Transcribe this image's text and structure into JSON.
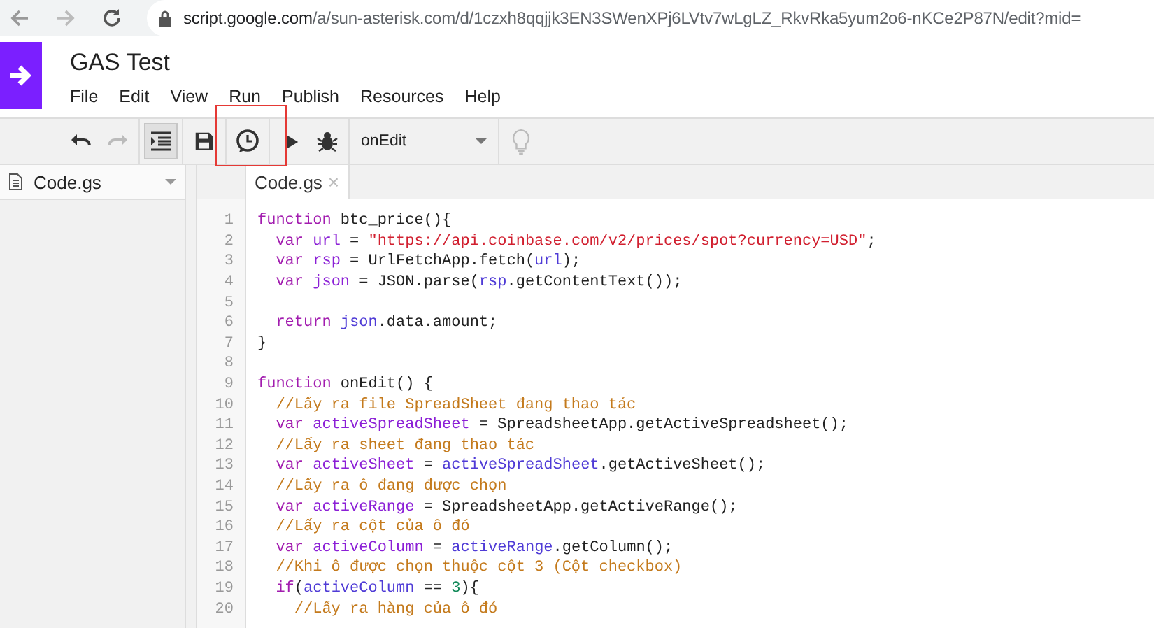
{
  "browser": {
    "url_host": "script.google.com",
    "url_path": "/a/sun-asterisk.com/d/1czxh8qqjjk3EN3SWenXPj6LVtv7wLgLZ_RkvRka5yum2o6-nKCe2P87N/edit?mid="
  },
  "project": {
    "title": "GAS Test"
  },
  "menu": [
    "File",
    "Edit",
    "View",
    "Run",
    "Publish",
    "Resources",
    "Help"
  ],
  "toolbar": [
    {
      "kind": "undo",
      "disabled": false,
      "selected": false
    },
    {
      "kind": "redo",
      "disabled": true,
      "selected": false
    },
    {
      "kind": "indent",
      "disabled": false,
      "selected": true
    },
    {
      "kind": "save",
      "disabled": false,
      "selected": false
    },
    {
      "kind": "triggers",
      "disabled": false,
      "selected": false,
      "highlighted": true
    },
    {
      "kind": "run",
      "disabled": false,
      "selected": false
    },
    {
      "kind": "debug",
      "disabled": false,
      "selected": false
    },
    {
      "kind": "function_select",
      "value": "onEdit"
    },
    {
      "kind": "bulb",
      "disabled": true,
      "selected": false
    }
  ],
  "sidebar": {
    "files": [
      {
        "name": "Code.gs"
      }
    ]
  },
  "tabs": [
    {
      "label": "Code.gs",
      "close": "×",
      "selected": true
    }
  ],
  "code": [
    {
      "n": "1",
      "tokens": [
        {
          "kind": "kw",
          "text": "function"
        },
        {
          "kind": "plain",
          "text": " btc_price(){"
        }
      ]
    },
    {
      "n": "2",
      "tokens": [
        {
          "kind": "kw",
          "text": "  var"
        },
        {
          "kind": "def",
          "text": " url"
        },
        {
          "kind": "plain",
          "text": " = "
        },
        {
          "kind": "str",
          "text": "\"https://api.coinbase.com/v2/prices/spot?currency=USD\""
        },
        {
          "kind": "plain",
          "text": ";"
        }
      ]
    },
    {
      "n": "3",
      "tokens": [
        {
          "kind": "kw",
          "text": "  var"
        },
        {
          "kind": "def",
          "text": " rsp"
        },
        {
          "kind": "plain",
          "text": " = UrlFetchApp.fetch("
        },
        {
          "kind": "var",
          "text": "url"
        },
        {
          "kind": "plain",
          "text": ");"
        }
      ]
    },
    {
      "n": "4",
      "tokens": [
        {
          "kind": "kw",
          "text": "  var"
        },
        {
          "kind": "def",
          "text": " json"
        },
        {
          "kind": "plain",
          "text": " = JSON.parse("
        },
        {
          "kind": "var",
          "text": "rsp"
        },
        {
          "kind": "plain",
          "text": ".getContentText());"
        }
      ]
    },
    {
      "n": "5"
    },
    {
      "n": "6",
      "tokens": [
        {
          "kind": "kw",
          "text": "  return"
        },
        {
          "kind": "var",
          "text": " json"
        },
        {
          "kind": "plain",
          "text": ".data.amount;"
        }
      ]
    },
    {
      "n": "7",
      "tokens": [
        {
          "kind": "plain",
          "text": "}"
        }
      ]
    },
    {
      "n": "8"
    },
    {
      "n": "9",
      "tokens": [
        {
          "kind": "kw",
          "text": "function"
        },
        {
          "kind": "plain",
          "text": " onEdit() {"
        }
      ]
    },
    {
      "n": "10",
      "tokens": [
        {
          "kind": "com",
          "text": "  //Lấy ra file SpreadSheet đang thao tác"
        }
      ]
    },
    {
      "n": "11",
      "tokens": [
        {
          "kind": "kw",
          "text": "  var"
        },
        {
          "kind": "def",
          "text": " activeSpreadSheet"
        },
        {
          "kind": "plain",
          "text": " = SpreadsheetApp.getActiveSpreadsheet();"
        }
      ]
    },
    {
      "n": "12",
      "tokens": [
        {
          "kind": "com",
          "text": "  //Lấy ra sheet đang thao tác"
        }
      ]
    },
    {
      "n": "13",
      "tokens": [
        {
          "kind": "kw",
          "text": "  var"
        },
        {
          "kind": "def",
          "text": " activeSheet"
        },
        {
          "kind": "plain",
          "text": " = "
        },
        {
          "kind": "var",
          "text": "activeSpreadSheet"
        },
        {
          "kind": "plain",
          "text": ".getActiveSheet();"
        }
      ]
    },
    {
      "n": "14",
      "tokens": [
        {
          "kind": "com",
          "text": "  //Lấy ra ô đang được chọn"
        }
      ]
    },
    {
      "n": "15",
      "tokens": [
        {
          "kind": "kw",
          "text": "  var"
        },
        {
          "kind": "def",
          "text": " activeRange"
        },
        {
          "kind": "plain",
          "text": " = SpreadsheetApp.getActiveRange();"
        }
      ]
    },
    {
      "n": "16",
      "tokens": [
        {
          "kind": "com",
          "text": "  //Lấy ra cột của ô đó"
        }
      ]
    },
    {
      "n": "17",
      "tokens": [
        {
          "kind": "kw",
          "text": "  var"
        },
        {
          "kind": "def",
          "text": " activeColumn"
        },
        {
          "kind": "plain",
          "text": " = "
        },
        {
          "kind": "var",
          "text": "activeRange"
        },
        {
          "kind": "plain",
          "text": ".getColumn();"
        }
      ]
    },
    {
      "n": "18",
      "tokens": [
        {
          "kind": "com",
          "text": "  //Khi ô được chọn thuộc cột 3 (Cột checkbox)"
        }
      ]
    },
    {
      "n": "19",
      "tokens": [
        {
          "kind": "kw",
          "text": "  if"
        },
        {
          "kind": "plain",
          "text": "("
        },
        {
          "kind": "var",
          "text": "activeColumn"
        },
        {
          "kind": "plain",
          "text": " == "
        },
        {
          "kind": "num",
          "text": "3"
        },
        {
          "kind": "plain",
          "text": "){"
        }
      ]
    },
    {
      "n": "20",
      "tokens": [
        {
          "kind": "com",
          "text": "    //Lấy ra hàng của ô đó"
        }
      ]
    }
  ]
}
